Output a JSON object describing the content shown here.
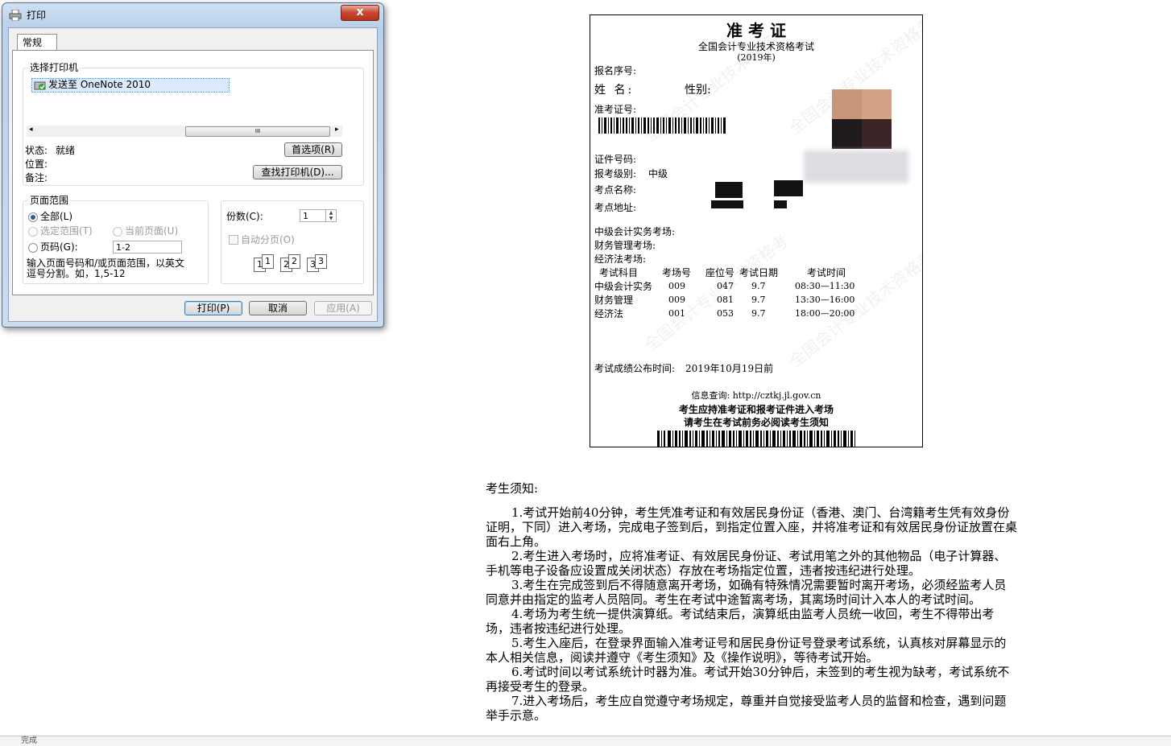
{
  "dialog": {
    "title": "打印",
    "close_label": "x",
    "tab_general": "常规",
    "printer_group_label": "选择打印机",
    "printer_name": "发送至 OneNote 2010",
    "scroll_thumb": "III",
    "status_label": "状态:",
    "status_value": "就绪",
    "location_label": "位置:",
    "comment_label": "备注:",
    "preferences_button": "首选项(R)",
    "find_printer_button": "查找打印机(D)...",
    "page_range_label": "页面范围",
    "range_all": "全部(L)",
    "range_selection": "选定范围(T)",
    "range_current": "当前页面(U)",
    "range_pages": "页码(G):",
    "range_pages_value": "1-2",
    "range_hint_line1": "输入页面号码和/或页面范围，以英文",
    "range_hint_line2": "逗号分割。如，1,5-12",
    "copies_label": "份数(C):",
    "copies_value": "1",
    "collate_label": "自动分页(O)",
    "collate_pages": [
      "1",
      "1",
      "2",
      "2",
      "3",
      "3"
    ],
    "print_button": "打印(P)",
    "cancel_button": "取消",
    "apply_button": "应用(A)"
  },
  "ticket": {
    "title": "准 考 证",
    "subtitle": "全国会计专业技术资格考试",
    "year": "(2019年)",
    "watermark": "全国会计专业技术资格考",
    "reg_no_label": "报名序号:",
    "name_label": "姓 名:",
    "gender_label": "性别:",
    "admit_no_label": "准考证号:",
    "id_no_label": "证件号码:",
    "level_label": "报考级别:",
    "level_value": "中级",
    "site_name_label": "考点名称:",
    "site_addr_label": "考点地址:",
    "room1_label": "中级会计实务考场:",
    "room2_label": "财务管理考场:",
    "room3_label": "经济法考场:",
    "table_headers": [
      "考试科目",
      "考场号",
      "座位号",
      "考试日期",
      "考试时间"
    ],
    "table_rows": [
      [
        "中级会计实务",
        "009",
        "047",
        "9.7",
        "08:30—11:30"
      ],
      [
        "财务管理",
        "009",
        "081",
        "9.7",
        "13:30—16:00"
      ],
      [
        "经济法",
        "001",
        "053",
        "9.7",
        "18:00—20:00"
      ]
    ],
    "results_label": "考试成绩公布时间:",
    "results_value": "2019年10月19日前",
    "info_query": "信息查询: http://cztkj.jl.gov.cn",
    "bold_line1": "考生应持准考证和报考证件进入考场",
    "bold_line2": "请考生在考试前务必阅读考生须知"
  },
  "notice": {
    "heading": "考生须知:",
    "items": [
      "1.考试开始前40分钟，考生凭准考证和有效居民身份证（香港、澳门、台湾籍考生凭有效身份证明，下同）进入考场，完成电子签到后，到指定位置入座，并将准考证和有效居民身份证放置在桌面右上角。",
      "2.考生进入考场时，应将准考证、有效居民身份证、考试用笔之外的其他物品（电子计算器、手机等电子设备应设置成关闭状态）存放在考场指定位置，违者按违纪进行处理。",
      "3.考生在完成签到后不得随意离开考场，如确有特殊情况需要暂时离开考场，必须经监考人员同意并由指定的监考人员陪同。考生在考试中途暂离考场，其离场时间计入本人的考试时间。",
      "4.考场为考生统一提供演算纸。考试结束后，演算纸由监考人员统一收回，考生不得带出考场，违者按违纪进行处理。",
      "5.考生入座后，在登录界面输入准考证号和居民身份证号登录考试系统，认真核对屏幕显示的本人相关信息，阅读并遵守《考生须知》及《操作说明》，等待考试开始。",
      "6.考试时间以考试系统计时器为准。考试开始30分钟后，未签到的考生视为缺考，考试系统不再接受考生的登录。",
      "7.进入考场后，考生应自觉遵守考场规定，尊重并自觉接受监考人员的监督和检查，遇到问题举手示意。"
    ]
  },
  "status_bar": {
    "text": "完成"
  }
}
